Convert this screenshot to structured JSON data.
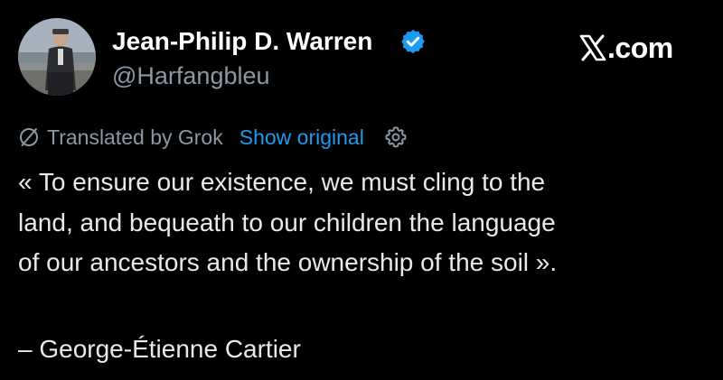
{
  "author": {
    "name": "Jean-Philip D. Warren",
    "handle": "@Harfangbleu",
    "verified": true,
    "verified_color": "#1d9bf0"
  },
  "site": {
    "brand_icon": "x-logo-icon",
    "label": ".com"
  },
  "translation": {
    "icon": "translate-icon",
    "label": "Translated by Grok",
    "link": "Show original",
    "settings_icon": "gear-icon",
    "link_color": "#1d9bf0"
  },
  "tweet": {
    "text": "« To ensure our existence, we must cling to the\nland, and bequeath to our children the language\nof our ancestors and the ownership of the soil ».",
    "signature": "– George-Étienne Cartier"
  },
  "colors": {
    "background": "#000000",
    "primary_text": "#e7e9ea",
    "secondary_text": "#8b98a5"
  }
}
